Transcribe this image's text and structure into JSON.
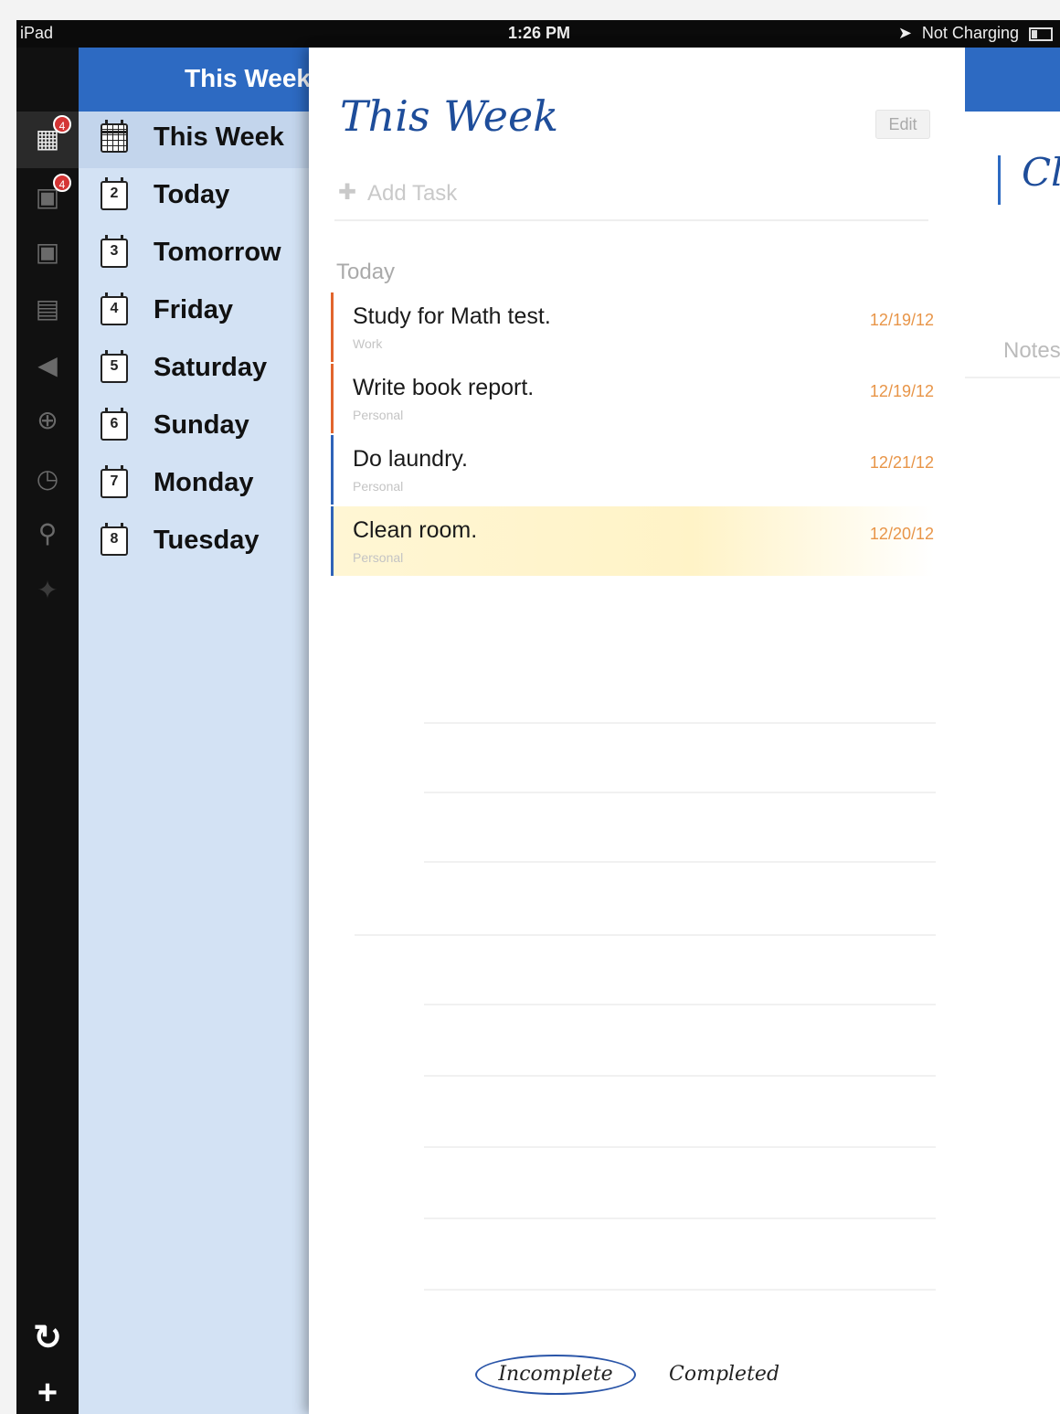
{
  "statusbar": {
    "device": "iPad",
    "time": "1:26 PM",
    "charging": "Not Charging"
  },
  "rail": {
    "icons": [
      {
        "name": "this-week-icon",
        "badge": "4"
      },
      {
        "name": "today-icon",
        "badge": "4"
      },
      {
        "name": "tomorrow-icon"
      },
      {
        "name": "notes-icon"
      },
      {
        "name": "tag-icon"
      },
      {
        "name": "globe-icon"
      },
      {
        "name": "clock-icon"
      },
      {
        "name": "search-icon"
      },
      {
        "name": "pin-icon"
      }
    ],
    "bottom": {
      "sync": "↻",
      "add": "+"
    }
  },
  "listpanel": {
    "header": "This Week",
    "items": [
      {
        "day": "",
        "label": "This Week"
      },
      {
        "day": "2",
        "label": "Today"
      },
      {
        "day": "3",
        "label": "Tomorrow"
      },
      {
        "day": "4",
        "label": "Friday"
      },
      {
        "day": "5",
        "label": "Saturday"
      },
      {
        "day": "6",
        "label": "Sunday"
      },
      {
        "day": "7",
        "label": "Monday"
      },
      {
        "day": "8",
        "label": "Tuesday"
      }
    ]
  },
  "main": {
    "title": "This Week",
    "edit": "Edit",
    "add_placeholder": "Add Task",
    "section": "Today",
    "tasks": [
      {
        "name": "Study for Math test.",
        "list": "Work",
        "date": "12/19/12",
        "color": "#e2652d"
      },
      {
        "name": "Write book report.",
        "list": "Personal",
        "date": "12/19/12",
        "color": "#e2652d"
      },
      {
        "name": "Do laundry.",
        "list": "Personal",
        "date": "12/21/12",
        "color": "#2f63b8"
      },
      {
        "name": "Clean room.",
        "list": "Personal",
        "date": "12/20/12",
        "color": "#2f63b8"
      }
    ],
    "tabs": {
      "incomplete": "Incomplete",
      "completed": "Completed"
    }
  },
  "detail": {
    "title": "Cl",
    "notes_label": "Notes"
  },
  "colors": {
    "accent": "#2d6ac2",
    "list_bg": "#d3e2f4",
    "date": "#e89548"
  }
}
